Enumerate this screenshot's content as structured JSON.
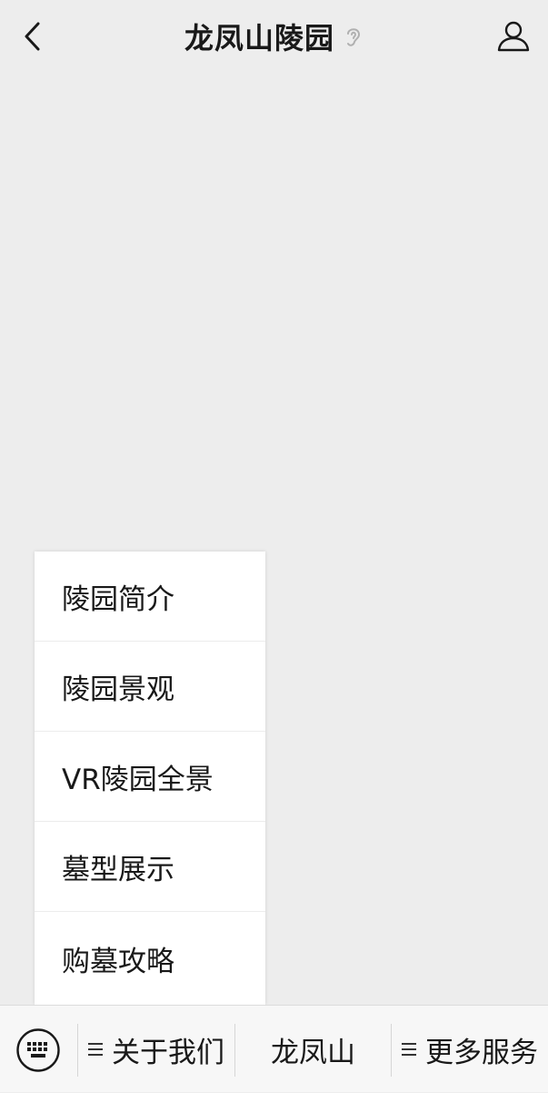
{
  "header": {
    "title": "龙凤山陵园"
  },
  "popup_menu": {
    "items": [
      {
        "label": "陵园简介"
      },
      {
        "label": "陵园景观"
      },
      {
        "label": "VR陵园全景"
      },
      {
        "label": "墓型展示"
      },
      {
        "label": "购墓攻略"
      }
    ]
  },
  "bottom_bar": {
    "menu_1": "关于我们",
    "menu_2": "龙凤山",
    "menu_3": "更多服务"
  }
}
